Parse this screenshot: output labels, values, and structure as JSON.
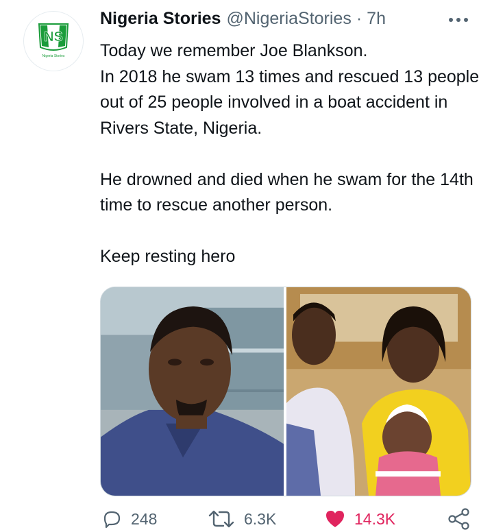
{
  "author": {
    "display_name": "Nigeria Stories",
    "handle": "@NigeriaStories",
    "separator": "·",
    "time": "7h",
    "avatar_logo": "NS",
    "avatar_caption": "Nigeria Stories"
  },
  "tweet": {
    "line1": "Today we remember Joe Blankson.",
    "line2": "In 2018 he swam 13 times and rescued 13 people out of 25 people involved in a boat accident in Rivers State, Nigeria.",
    "line3": "He drowned  and died when he swam for the 14th time to rescue another person.",
    "line4": "Keep resting hero"
  },
  "actions": {
    "reply": {
      "icon": "reply-icon",
      "count": "248"
    },
    "retweet": {
      "icon": "retweet-icon",
      "count": "6.3K"
    },
    "like": {
      "icon": "heart-icon",
      "count": "14.3K",
      "color": "#e0245e"
    },
    "share": {
      "icon": "share-icon"
    }
  },
  "colors": {
    "text": "#0f1419",
    "secondary": "#536471",
    "logo_green": "#1a9c3a",
    "border": "#cfd9de"
  },
  "icons": {
    "more": "more-options-icon"
  }
}
